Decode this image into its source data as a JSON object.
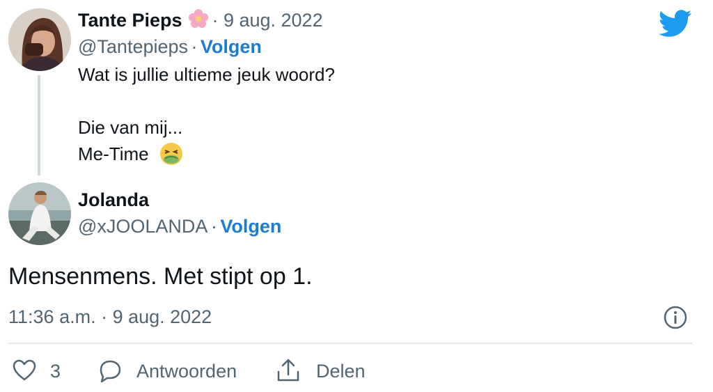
{
  "original_tweet": {
    "display_name": "Tante Pieps",
    "date": "· 9 aug. 2022",
    "handle": "@Tantepieps",
    "separator": "·",
    "follow_label": "Volgen",
    "text_line1": "Wat is jullie ultieme jeuk woord?",
    "text_line2": "Die van mij...",
    "text_line3": "Me-Time",
    "flower_emoji": "flower-icon",
    "sick_emoji": "nauseated-face-icon"
  },
  "reply": {
    "display_name": "Jolanda",
    "handle": "@xJOOLANDA",
    "separator": "·",
    "follow_label": "Volgen",
    "text": "Mensenmens. Met stipt op 1.",
    "timestamp": "11:36 a.m. · 9 aug. 2022"
  },
  "actions": {
    "like_count": "3",
    "reply_label": "Antwoorden",
    "share_label": "Delen"
  },
  "colors": {
    "twitter_blue": "#1d9bf0",
    "follow_blue": "#1d7bd8",
    "muted_text": "#536471"
  }
}
